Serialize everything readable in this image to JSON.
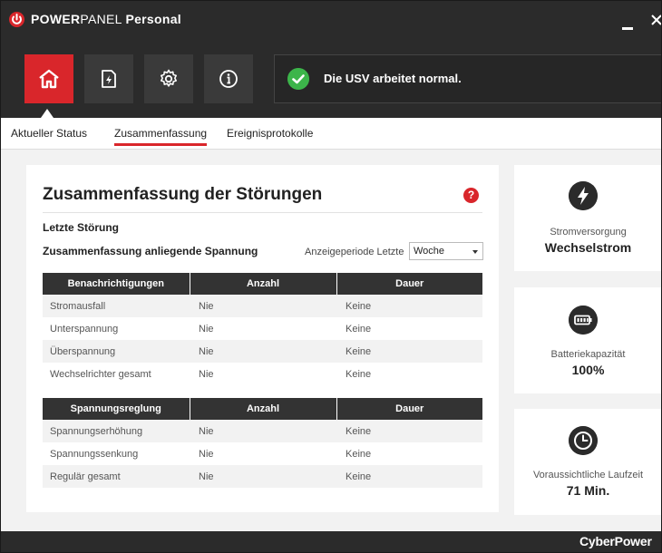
{
  "titlebar": {
    "app_brand_bold": "POWER",
    "app_brand_rest": "PANEL",
    "app_edition": "Personal"
  },
  "toolbar": {
    "buttons": [
      {
        "name": "home",
        "icon": "home-icon",
        "active": true
      },
      {
        "name": "energy",
        "icon": "document-bolt-icon",
        "active": false
      },
      {
        "name": "settings",
        "icon": "gear-icon",
        "active": false
      },
      {
        "name": "info",
        "icon": "info-icon",
        "active": false
      }
    ],
    "status_text": "Die USV arbeitet normal."
  },
  "tabs": [
    "Aktueller Status",
    "Zusammenfassung",
    "Ereignisprotokolle"
  ],
  "active_tab": "Zusammenfassung",
  "summary": {
    "title": "Zusammenfassung der Störungen",
    "help_symbol": "?",
    "last_fault_label": "Letzte Störung",
    "voltage_summary_label": "Zusammenfassung anliegende Spannung",
    "period_label": "Anzeigeperiode Letzte",
    "period_value": "Woche",
    "notifications_table": {
      "headers": [
        "Benachrichtigungen",
        "Anzahl",
        "Dauer"
      ],
      "rows": [
        [
          "Stromausfall",
          "Nie",
          "Keine"
        ],
        [
          "Unterspannung",
          "Nie",
          "Keine"
        ],
        [
          "Überspannung",
          "Nie",
          "Keine"
        ],
        [
          "Wechselrichter gesamt",
          "Nie",
          "Keine"
        ]
      ]
    },
    "regulation_table": {
      "headers": [
        "Spannungsreglung",
        "Anzahl",
        "Dauer"
      ],
      "rows": [
        [
          "Spannungserhöhung",
          "Nie",
          "Keine"
        ],
        [
          "Spannungssenkung",
          "Nie",
          "Keine"
        ],
        [
          "Regulär gesamt",
          "Nie",
          "Keine"
        ]
      ]
    }
  },
  "side_cards": [
    {
      "icon": "lightning-icon",
      "label": "Stromversorgung",
      "value": "Wechselstrom"
    },
    {
      "icon": "battery-icon",
      "label": "Batteriekapazität",
      "value": "100%"
    },
    {
      "icon": "clock-icon",
      "label": "Voraussichtliche Laufzeit",
      "value": "71 Min."
    }
  ],
  "footer": {
    "brand": "CyberPower"
  },
  "colors": {
    "accent": "#d9262b",
    "dark": "#2b2b2b",
    "ok": "#3cb54a"
  }
}
